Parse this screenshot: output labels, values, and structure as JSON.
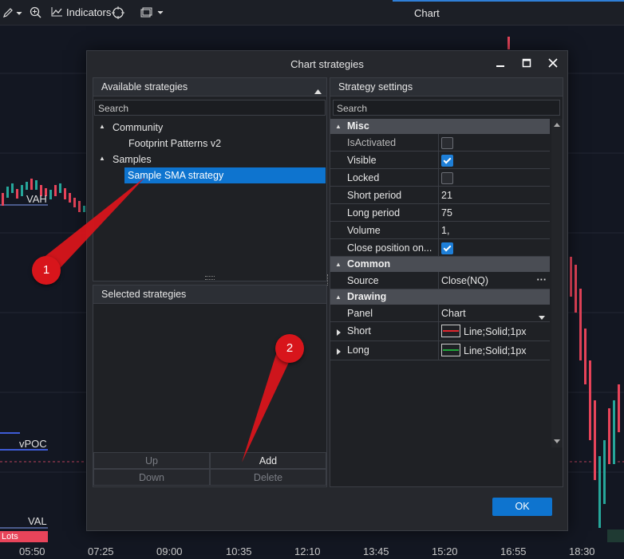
{
  "toolbar": {
    "indicators_label": "Indicators",
    "window_title": "Chart",
    "icons": [
      "pencil-icon",
      "zoom-icon",
      "indicators-chart-icon",
      "crosshair-icon",
      "windows-icon"
    ]
  },
  "chart": {
    "levels": {
      "vah": "VAH",
      "vpoc": "vPOC",
      "val": "VAL"
    },
    "lots_label": "Lots",
    "time_axis": [
      "05:50",
      "07:25",
      "09:00",
      "10:35",
      "12:10",
      "13:45",
      "15:20",
      "16:55",
      "18:30"
    ]
  },
  "dialog": {
    "title": "Chart strategies",
    "available": {
      "header": "Available strategies",
      "search_placeholder": "Search",
      "tree": [
        {
          "label": "Community",
          "children": [
            "Footprint Patterns v2"
          ]
        },
        {
          "label": "Samples",
          "children": [
            "Sample SMA strategy"
          ]
        }
      ],
      "selected_item": "Sample SMA strategy"
    },
    "selected": {
      "header": "Selected strategies",
      "buttons": {
        "up": "Up",
        "add": "Add",
        "down": "Down",
        "delete": "Delete"
      }
    },
    "settings": {
      "header": "Strategy settings",
      "search_placeholder": "Search",
      "categories": {
        "misc": "Misc",
        "common": "Common",
        "drawing": "Drawing"
      },
      "props": {
        "isactivated": {
          "name": "IsActivated",
          "checked": false
        },
        "visible": {
          "name": "Visible",
          "checked": true
        },
        "locked": {
          "name": "Locked",
          "checked": false
        },
        "short_period": {
          "name": "Short period",
          "value": "21"
        },
        "long_period": {
          "name": "Long period",
          "value": "75"
        },
        "volume": {
          "name": "Volume",
          "value": "1,"
        },
        "close_position": {
          "name": "Close position on...",
          "checked": true
        },
        "source": {
          "name": "Source",
          "value": "Close(NQ)",
          "more": "···"
        },
        "panel": {
          "name": "Panel",
          "value": "Chart"
        },
        "short": {
          "name": "Short",
          "value": "Line;Solid;1px",
          "color": "#e0262d"
        },
        "long": {
          "name": "Long",
          "value": "Line;Solid;1px",
          "color": "#1fa53a"
        }
      }
    },
    "ok_label": "OK"
  },
  "annotations": {
    "badge1": "1",
    "badge2": "2",
    "color": "#d8151b"
  }
}
